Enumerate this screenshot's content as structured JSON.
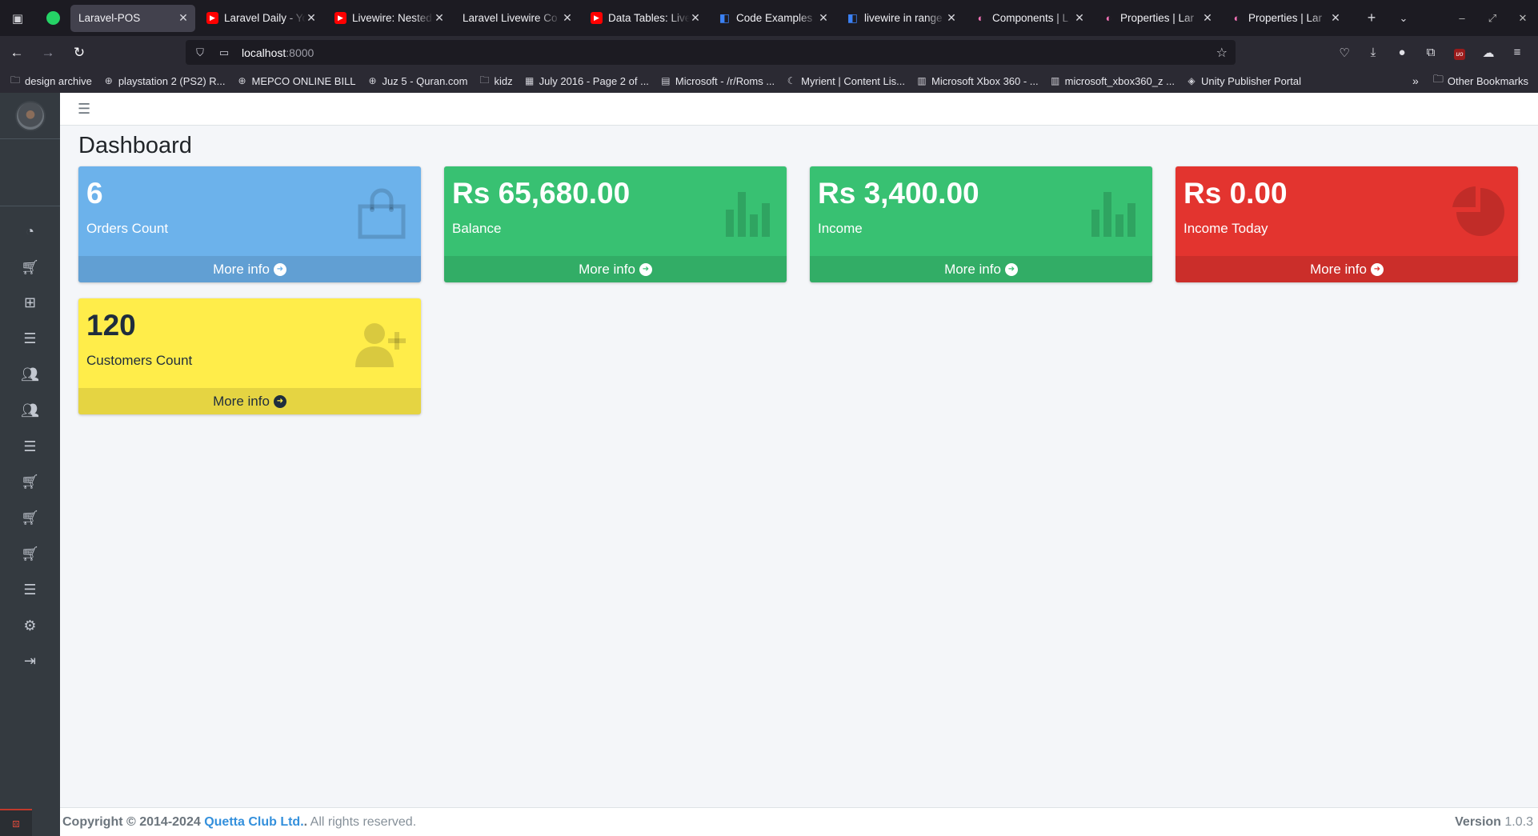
{
  "browser": {
    "tabs": [
      {
        "title": "Laravel-POS",
        "favicon": "none",
        "active": true
      },
      {
        "title": "Laravel Daily - Yo",
        "favicon": "youtube",
        "active": false
      },
      {
        "title": "Livewire: Nested",
        "favicon": "youtube",
        "active": false
      },
      {
        "title": "Laravel Livewire Co",
        "favicon": "none",
        "active": false
      },
      {
        "title": "Data Tables: Live",
        "favicon": "youtube",
        "active": false
      },
      {
        "title": "Code Examples",
        "favicon": "doc-blue",
        "active": false
      },
      {
        "title": "livewire in range",
        "favicon": "doc-blue",
        "active": false
      },
      {
        "title": "Components | L",
        "favicon": "pink",
        "active": false
      },
      {
        "title": "Properties | Lar",
        "favicon": "pink",
        "active": false
      },
      {
        "title": "Properties | Lar",
        "favicon": "pink",
        "active": false
      }
    ],
    "url_host": "localhost",
    "url_port": ":8000",
    "bookmarks": [
      {
        "label": "design archive",
        "icon": "folder-icon"
      },
      {
        "label": "playstation 2 (PS2) R...",
        "icon": "globe-icon"
      },
      {
        "label": "MEPCO ONLINE BILL",
        "icon": "globe-icon"
      },
      {
        "label": "Juz 5 - Quran.com",
        "icon": "globe-icon"
      },
      {
        "label": "kidz",
        "icon": "folder-icon"
      },
      {
        "label": "July 2016 - Page 2 of ...",
        "icon": "image-icon"
      },
      {
        "label": "Microsoft - /r/Roms ...",
        "icon": "page-icon"
      },
      {
        "label": "Myrient | Content Lis...",
        "icon": "moon-icon"
      },
      {
        "label": "Microsoft Xbox 360 - ...",
        "icon": "archive-icon"
      },
      {
        "label": "microsoft_xbox360_z ...",
        "icon": "archive-icon"
      },
      {
        "label": "Unity Publisher Portal",
        "icon": "unity-icon"
      }
    ],
    "other_bookmarks": "Other Bookmarks"
  },
  "page": {
    "title": "Dashboard"
  },
  "cards": [
    {
      "value": "6",
      "label": "Orders Count",
      "link": "More info",
      "icon": "shopping-bag-icon",
      "color": "#6cb2eb"
    },
    {
      "value": "Rs 65,680.00",
      "label": "Balance",
      "link": "More info",
      "icon": "bar-chart-icon",
      "color": "#38c172"
    },
    {
      "value": "Rs 3,400.00",
      "label": "Income",
      "link": "More info",
      "icon": "bar-chart-icon",
      "color": "#38c172"
    },
    {
      "value": "Rs 0.00",
      "label": "Income Today",
      "link": "More info",
      "icon": "pie-chart-icon",
      "color": "#e3342f"
    },
    {
      "value": "120",
      "label": "Customers Count",
      "link": "More info",
      "icon": "user-plus-icon",
      "color": "#ffed4a"
    }
  ],
  "sidebar": {
    "items": [
      {
        "icon": "dashboard-icon"
      },
      {
        "icon": "cart-icon"
      },
      {
        "icon": "grid-icon"
      },
      {
        "icon": "list-icon"
      },
      {
        "icon": "users-icon"
      },
      {
        "icon": "users-icon"
      },
      {
        "icon": "list-icon"
      },
      {
        "icon": "cart-icon"
      },
      {
        "icon": "cart-icon"
      },
      {
        "icon": "cart-icon"
      },
      {
        "icon": "list-icon"
      },
      {
        "icon": "settings-icon"
      },
      {
        "icon": "logout-icon"
      }
    ]
  },
  "footer": {
    "copyright": "Copyright © 2014-2024",
    "company": "Quetta Club Ltd.",
    "dot": ".",
    "rights": " All rights reserved.",
    "version_label": "Version",
    "version": "1.0.3"
  }
}
